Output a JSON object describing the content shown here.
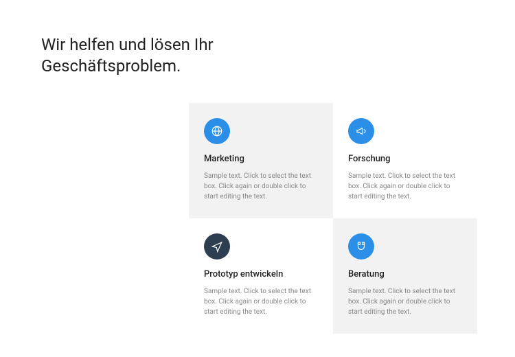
{
  "heading": "Wir helfen und lösen Ihr Geschäftsproblem.",
  "cards": [
    {
      "title": "Marketing",
      "body": "Sample text. Click to select the text box. Click again or double click to start editing the text."
    },
    {
      "title": "Forschung",
      "body": "Sample text. Click to select the text box. Click again or double click to start editing the text."
    },
    {
      "title": "Prototyp entwickeln",
      "body": "Sample text. Click to select the text box. Click again or double click to start editing the text."
    },
    {
      "title": "Beratung",
      "body": "Sample text. Click to select the text box. Click again or double click to start editing the text."
    }
  ]
}
